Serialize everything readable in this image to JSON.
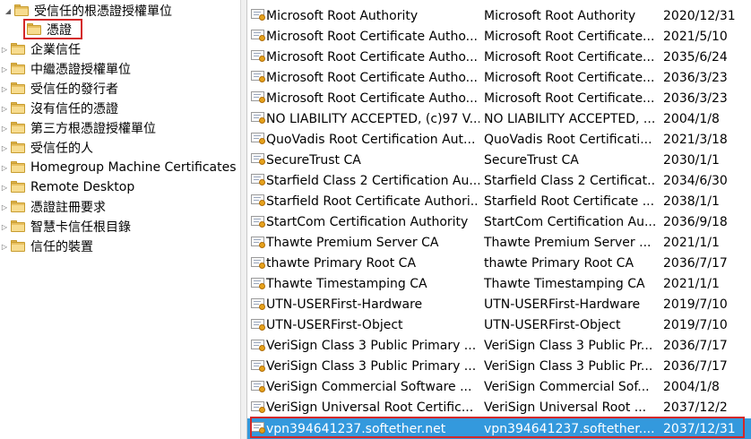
{
  "tree": {
    "root_label": "受信任的根憑證授權單位",
    "selected_child_label": "憑證",
    "items": [
      {
        "label": "企業信任"
      },
      {
        "label": "中繼憑證授權單位"
      },
      {
        "label": "受信任的發行者"
      },
      {
        "label": "沒有信任的憑證"
      },
      {
        "label": "第三方根憑證授權單位"
      },
      {
        "label": "受信任的人"
      },
      {
        "label": "Homegroup Machine Certificates"
      },
      {
        "label": "Remote Desktop"
      },
      {
        "label": "憑證註冊要求"
      },
      {
        "label": "智慧卡信任根目錄"
      },
      {
        "label": "信任的裝置"
      }
    ]
  },
  "certificates": {
    "rows": [
      {
        "issued_to": "Microsoft Root Authority",
        "issued_by": "Microsoft Root Authority",
        "expires": "2020/12/31"
      },
      {
        "issued_to": "Microsoft Root Certificate Autho...",
        "issued_by": "Microsoft Root Certificate...",
        "expires": "2021/5/10"
      },
      {
        "issued_to": "Microsoft Root Certificate Autho...",
        "issued_by": "Microsoft Root Certificate...",
        "expires": "2035/6/24"
      },
      {
        "issued_to": "Microsoft Root Certificate Autho...",
        "issued_by": "Microsoft Root Certificate...",
        "expires": "2036/3/23"
      },
      {
        "issued_to": "Microsoft Root Certificate Autho...",
        "issued_by": "Microsoft Root Certificate...",
        "expires": "2036/3/23"
      },
      {
        "issued_to": "NO LIABILITY ACCEPTED, (c)97 V...",
        "issued_by": "NO LIABILITY ACCEPTED, ...",
        "expires": "2004/1/8"
      },
      {
        "issued_to": "QuoVadis Root Certification Aut...",
        "issued_by": "QuoVadis Root Certificati...",
        "expires": "2021/3/18"
      },
      {
        "issued_to": "SecureTrust CA",
        "issued_by": "SecureTrust CA",
        "expires": "2030/1/1"
      },
      {
        "issued_to": "Starfield Class 2 Certification Au...",
        "issued_by": "Starfield Class 2 Certificat...",
        "expires": "2034/6/30"
      },
      {
        "issued_to": "Starfield Root Certificate Authori...",
        "issued_by": "Starfield Root Certificate ...",
        "expires": "2038/1/1"
      },
      {
        "issued_to": "StartCom Certification Authority",
        "issued_by": "StartCom Certification Au...",
        "expires": "2036/9/18"
      },
      {
        "issued_to": "Thawte Premium Server CA",
        "issued_by": "Thawte Premium Server ...",
        "expires": "2021/1/1"
      },
      {
        "issued_to": "thawte Primary Root CA",
        "issued_by": "thawte Primary Root CA",
        "expires": "2036/7/17"
      },
      {
        "issued_to": "Thawte Timestamping CA",
        "issued_by": "Thawte Timestamping CA",
        "expires": "2021/1/1"
      },
      {
        "issued_to": "UTN-USERFirst-Hardware",
        "issued_by": "UTN-USERFirst-Hardware",
        "expires": "2019/7/10"
      },
      {
        "issued_to": "UTN-USERFirst-Object",
        "issued_by": "UTN-USERFirst-Object",
        "expires": "2019/7/10"
      },
      {
        "issued_to": "VeriSign Class 3 Public Primary ...",
        "issued_by": "VeriSign Class 3 Public Pr...",
        "expires": "2036/7/17"
      },
      {
        "issued_to": "VeriSign Class 3 Public Primary ...",
        "issued_by": "VeriSign Class 3 Public Pr...",
        "expires": "2036/7/17"
      },
      {
        "issued_to": "VeriSign Commercial Software ...",
        "issued_by": "VeriSign Commercial Sof...",
        "expires": "2004/1/8"
      },
      {
        "issued_to": "VeriSign Universal Root Certific...",
        "issued_by": "VeriSign Universal Root ...",
        "expires": "2037/12/2"
      },
      {
        "issued_to": "vpn394641237.softether.net",
        "issued_by": "vpn394641237.softether....",
        "expires": "2037/12/31"
      }
    ]
  },
  "colors": {
    "selection": "#3399dd",
    "highlight_box": "#d42828",
    "folder": "#e8c060"
  },
  "icons": {
    "tree_node": "folder-icon",
    "tree_expanded": "triangle-down-icon",
    "tree_collapsed": "triangle-right-icon",
    "list_row": "certificate-icon"
  }
}
